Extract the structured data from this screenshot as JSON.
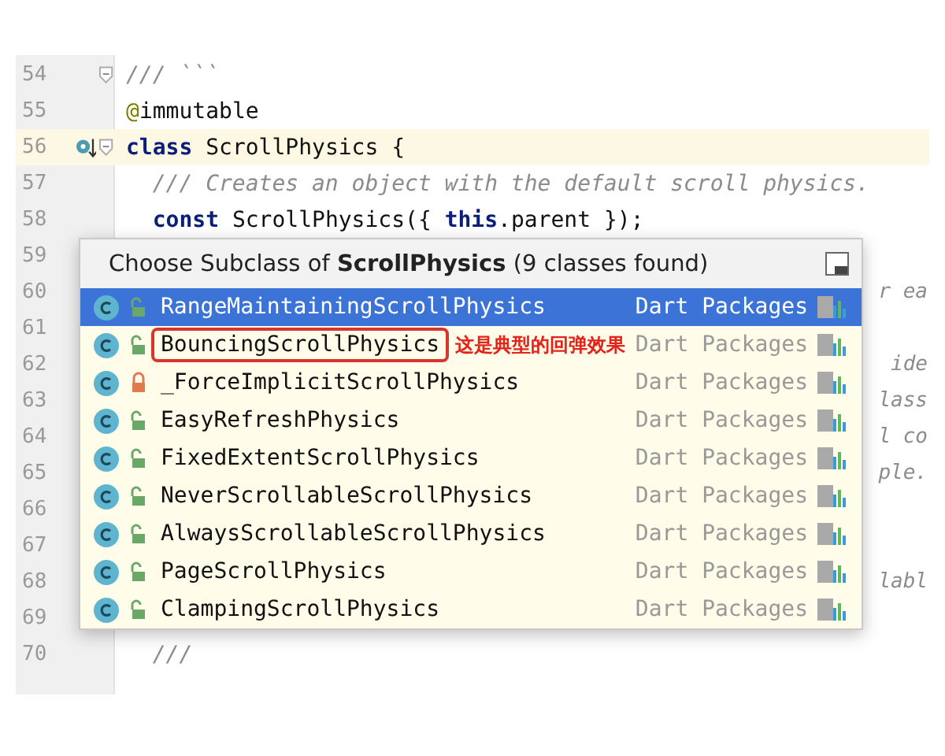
{
  "editor": {
    "lines": [
      {
        "number": "54",
        "code": "/// ```",
        "kind": "comment",
        "fold": true
      },
      {
        "number": "55",
        "code": "@immutable",
        "kind": "annotation"
      },
      {
        "number": "56",
        "code": "**class** ScrollPhysics {",
        "kind": "code",
        "current": true,
        "fold": true,
        "override": true
      },
      {
        "number": "57",
        "code": "  /// Creates an object with the default scroll physics.",
        "kind": "comment"
      },
      {
        "number": "58",
        "code": "  **const** ScrollPhysics({ **this**.parent });",
        "kind": "code"
      },
      {
        "number": "59"
      },
      {
        "number": "60",
        "tail": "r ea"
      },
      {
        "number": "61"
      },
      {
        "number": "62",
        "tail": "ide"
      },
      {
        "number": "63",
        "tail": "lass"
      },
      {
        "number": "64",
        "tail": "l co"
      },
      {
        "number": "65",
        "tail": "ple."
      },
      {
        "number": "66"
      },
      {
        "number": "67"
      },
      {
        "number": "68",
        "tail": "labl"
      },
      {
        "number": "69"
      },
      {
        "number": "70",
        "code": "  ///",
        "kind": "comment"
      }
    ]
  },
  "popup": {
    "title": "Choose Subclass of **ScrollPhysics** (9 classes found)",
    "rows": [
      {
        "name": "RangeMaintainingScrollPhysics",
        "location": "Dart Packages",
        "selected": true,
        "locked": false
      },
      {
        "name": "BouncingScrollPhysics",
        "location": "Dart Packages",
        "selected": false,
        "locked": false,
        "highlighted": true,
        "note": "这是典型的回弹效果"
      },
      {
        "name": "_ForceImplicitScrollPhysics",
        "location": "Dart Packages",
        "selected": false,
        "locked": true
      },
      {
        "name": "EasyRefreshPhysics",
        "location": "Dart Packages",
        "selected": false,
        "locked": false
      },
      {
        "name": "FixedExtentScrollPhysics",
        "location": "Dart Packages",
        "selected": false,
        "locked": false
      },
      {
        "name": "NeverScrollableScrollPhysics",
        "location": "Dart Packages",
        "selected": false,
        "locked": false
      },
      {
        "name": "AlwaysScrollableScrollPhysics",
        "location": "Dart Packages",
        "selected": false,
        "locked": false
      },
      {
        "name": "PageScrollPhysics",
        "location": "Dart Packages",
        "selected": false,
        "locked": false
      },
      {
        "name": "ClampingScrollPhysics",
        "location": "Dart Packages",
        "selected": false,
        "locked": false
      }
    ]
  }
}
